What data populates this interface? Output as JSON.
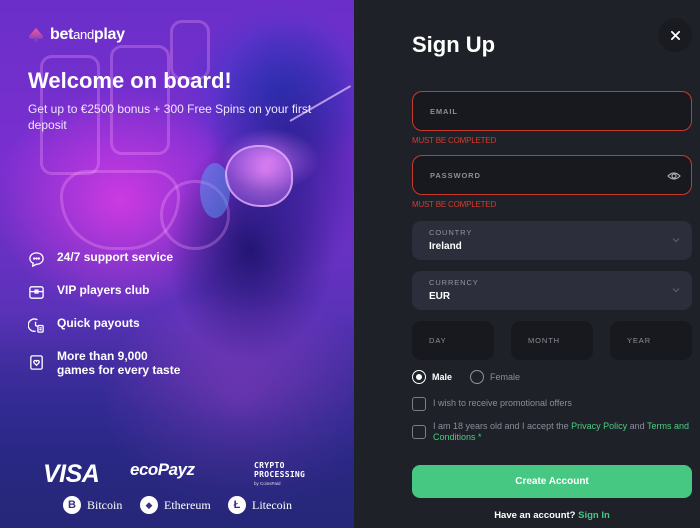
{
  "brand": {
    "name_part1": "bet",
    "name_part2": "and",
    "name_part3": "play",
    "accent": "#f04a8a"
  },
  "promo": {
    "heading": "Welcome on board!",
    "bonus_text": "Get up to €2500 bonus + 300 Free Spins on your first deposit"
  },
  "features": [
    {
      "icon": "chat-support-icon",
      "label": "24/7 support service"
    },
    {
      "icon": "treasure-chest-icon",
      "label": "VIP players club"
    },
    {
      "icon": "clock-payout-icon",
      "label": "Quick payouts"
    },
    {
      "icon": "playing-card-icon",
      "label": "More than 9,000 games for every taste"
    }
  ],
  "payments": {
    "visa": "VISA",
    "ecopayz": "ecoPayz",
    "crypto_line1": "CRYPTO",
    "crypto_line2": "PROCESSING",
    "crypto_by": "by CoinsPaid",
    "coins": [
      {
        "symbol": "B",
        "name": "Bitcoin"
      },
      {
        "symbol": "◆",
        "name": "Ethereum"
      },
      {
        "symbol": "Ł",
        "name": "Litecoin"
      }
    ]
  },
  "form": {
    "title": "Sign Up",
    "close_label": "×",
    "email_placeholder": "EMAIL",
    "email_error": "MUST BE COMPLETED",
    "password_placeholder": "PASSWORD",
    "password_error": "MUST BE COMPLETED",
    "country_label": "COUNTRY",
    "country_value": "Ireland",
    "currency_label": "CURRENCY",
    "currency_value": "EUR",
    "day_placeholder": "DAY",
    "month_placeholder": "MONTH",
    "year_placeholder": "YEAR",
    "gender_male": "Male",
    "gender_female": "Female",
    "gender_selected": "Male",
    "promo_optin": "I wish to receive promotional offers",
    "terms_prefix": "I am 18 years old and I accept the ",
    "privacy_link": "Privacy Policy",
    "terms_and": " and ",
    "terms_link": "Terms and Conditions",
    "terms_required": " *",
    "create_button": "Create Account",
    "have_account": "Have an account? ",
    "sign_in_link": "Sign In"
  },
  "colors": {
    "error": "#d83a2a",
    "success_green": "#46c882",
    "panel_bg": "#1f2129",
    "input_bg": "#18191e",
    "select_bg": "#2c2f3b"
  }
}
